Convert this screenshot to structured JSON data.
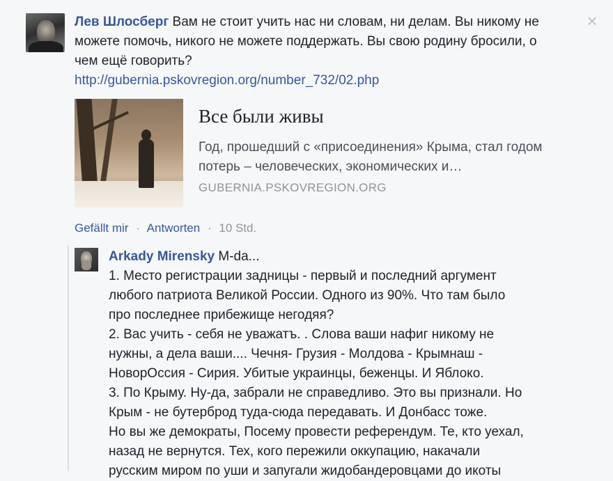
{
  "comment": {
    "author": "Лев Шлосберг",
    "text": "Вам не стоит учить нас ни словам, ни делам. Вы никому не можете помочь, никого не можете поддержать. Вы свою родину бросили, о чем ещё говорить?",
    "link": "http://gubernia.pskovregion.org/number_732/02.php",
    "close_icon": "×"
  },
  "preview": {
    "title": "Все были живы",
    "description": "Год, прошедший с «присоединения» Крыма, стал годом потерь – человеческих, экономических и…",
    "domain": "GUBERNIA.PSKOVREGION.ORG"
  },
  "actions": {
    "like": "Gefällt mir",
    "sep1": "·",
    "reply": "Antworten",
    "sep2": "·",
    "time": "10 Std."
  },
  "reply": {
    "author": "Arkady Mirensky",
    "first": "M-da...",
    "lines": [
      "1. Место регистрации задницы - первый и последний аргумент",
      "любого патриота Великой России. Одного из 90%. Что там было",
      "про последнее прибежище негодяя?",
      "2. Вас учить - себя не уважатъ. . Слова ваши нафиг никому не",
      "нужны, а дела ваши.... Чечня- Грузия - Молдова - Крымнаш -",
      "НоворОссия - Сирия. Убитые украинцы, беженцы. И Яблоко.",
      "3. По Крыму. Ну-да, забрали не справедливо. Это вы признали. Но",
      "Крым - не бутерброд туда-сюда передавать. И Донбасс тоже.",
      "Но вы же демократы, Посему провести референдум. Те, кто уехал,",
      "назад не вернутся. Тех, кого пережили оккупацию, накачали",
      "русским миром по уши и запугали жидобандеровцами до икоты"
    ]
  },
  "colors": {
    "link": "#365899",
    "text": "#1d2129",
    "muted": "#90949c",
    "background": "#f6f7f9"
  }
}
